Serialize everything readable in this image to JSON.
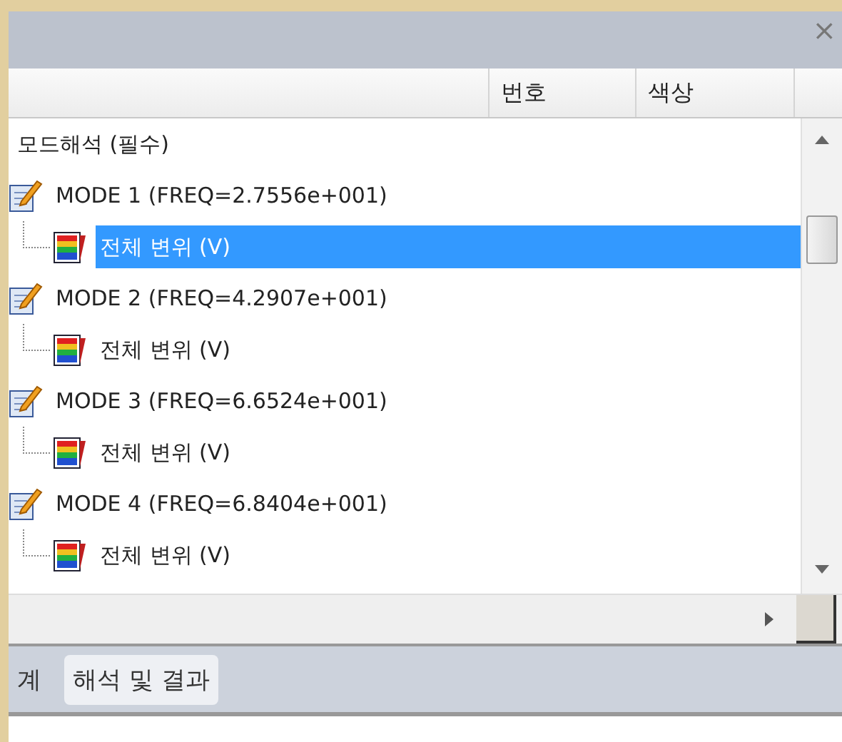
{
  "window": {
    "close": "×"
  },
  "table": {
    "columns": [
      {},
      {
        "label": "번호"
      },
      {
        "label": "색상"
      }
    ]
  },
  "tree": [
    {
      "label": "모드해석 (필수)",
      "selected": false,
      "children": [
        {
          "label": "MODE 1 (FREQ=2.7556e+001)",
          "kind": "mode",
          "selected": false,
          "children": [
            {
              "label": "전체 변위 (V)",
              "kind": "result",
              "selected": true
            }
          ]
        },
        {
          "label": "MODE 2 (FREQ=4.2907e+001)",
          "kind": "mode",
          "selected": false,
          "children": [
            {
              "label": "전체 변위 (V)",
              "kind": "result",
              "selected": false
            }
          ]
        },
        {
          "label": "MODE 3 (FREQ=6.6524e+001)",
          "kind": "mode",
          "selected": false,
          "children": [
            {
              "label": "전체 변위 (V)",
              "kind": "result",
              "selected": false
            }
          ]
        },
        {
          "label": "MODE 4 (FREQ=6.8404e+001)",
          "kind": "mode",
          "selected": false,
          "children": [
            {
              "label": "전체 변위 (V)",
              "kind": "result",
              "selected": false
            }
          ]
        }
      ]
    }
  ],
  "tabs": [
    {
      "label": "계",
      "selected": false
    },
    {
      "label": "해석 및 결과",
      "selected": true
    }
  ]
}
